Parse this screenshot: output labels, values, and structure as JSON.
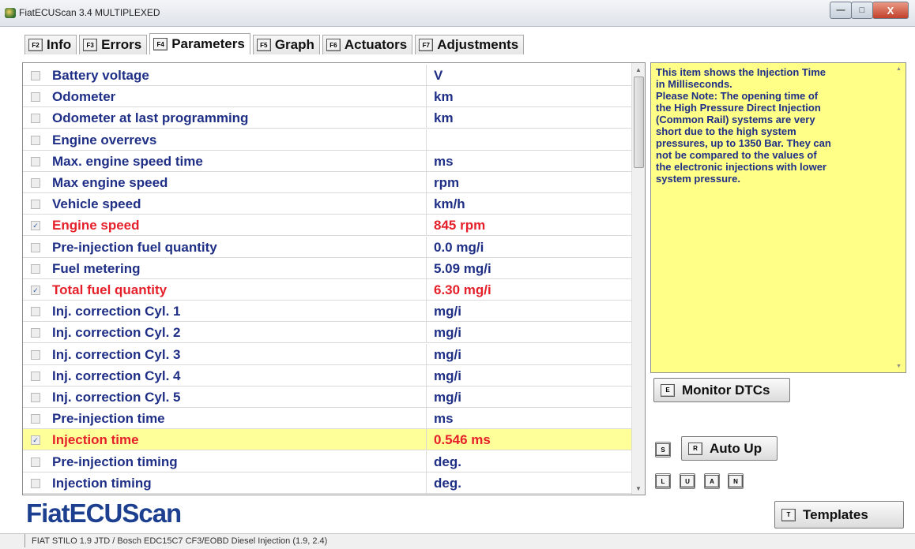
{
  "window": {
    "title": "FiatECUScan 3.4 MULTIPLEXED",
    "min_glyph": "—",
    "max_glyph": "□",
    "close_glyph": "X"
  },
  "tabs": [
    {
      "key": "F2",
      "label": "Info",
      "active": false
    },
    {
      "key": "F3",
      "label": "Errors",
      "active": false
    },
    {
      "key": "F4",
      "label": "Parameters",
      "active": true
    },
    {
      "key": "F5",
      "label": "Graph",
      "active": false
    },
    {
      "key": "F6",
      "label": "Actuators",
      "active": false
    },
    {
      "key": "F7",
      "label": "Adjustments",
      "active": false
    }
  ],
  "parameters": [
    {
      "name": "Battery voltage",
      "value": "V",
      "checked": false,
      "highlight": false
    },
    {
      "name": "Odometer",
      "value": "km",
      "checked": false,
      "highlight": false
    },
    {
      "name": "Odometer at last programming",
      "value": "km",
      "checked": false,
      "highlight": false
    },
    {
      "name": "Engine overrevs",
      "value": "",
      "checked": false,
      "highlight": false
    },
    {
      "name": "Max. engine speed time",
      "value": "ms",
      "checked": false,
      "highlight": false
    },
    {
      "name": "Max engine speed",
      "value": "rpm",
      "checked": false,
      "highlight": false
    },
    {
      "name": "Vehicle speed",
      "value": "km/h",
      "checked": false,
      "highlight": false
    },
    {
      "name": "Engine speed",
      "value": "845 rpm",
      "checked": true,
      "highlight": false
    },
    {
      "name": "Pre-injection fuel quantity",
      "value": "0.0 mg/i",
      "checked": false,
      "highlight": false
    },
    {
      "name": "Fuel metering",
      "value": "5.09 mg/i",
      "checked": false,
      "highlight": false
    },
    {
      "name": "Total fuel quantity",
      "value": "6.30 mg/i",
      "checked": true,
      "highlight": false
    },
    {
      "name": "Inj. correction Cyl. 1",
      "value": "mg/i",
      "checked": false,
      "highlight": false
    },
    {
      "name": "Inj. correction Cyl. 2",
      "value": "mg/i",
      "checked": false,
      "highlight": false
    },
    {
      "name": "Inj. correction Cyl. 3",
      "value": "mg/i",
      "checked": false,
      "highlight": false
    },
    {
      "name": "Inj. correction Cyl. 4",
      "value": "mg/i",
      "checked": false,
      "highlight": false
    },
    {
      "name": "Inj. correction Cyl. 5",
      "value": "mg/i",
      "checked": false,
      "highlight": false
    },
    {
      "name": "Pre-injection time",
      "value": "ms",
      "checked": false,
      "highlight": false
    },
    {
      "name": "Injection time",
      "value": "0.546 ms",
      "checked": true,
      "highlight": true
    },
    {
      "name": "Pre-injection timing",
      "value": "deg.",
      "checked": false,
      "highlight": false
    },
    {
      "name": "Injection timing",
      "value": "deg.",
      "checked": false,
      "highlight": false
    }
  ],
  "info_panel": {
    "text": "This item shows the Injection Time\nin Milliseconds.\nPlease Note: The opening time of\nthe High Pressure Direct Injection\n(Common Rail) systems are very\nshort due to the high system\npressures, up to 1350 Bar. They can\nnot be compared to the values of\nthe electronic injections with lower\nsystem pressure."
  },
  "buttons": {
    "monitor_dtcs": {
      "key": "E",
      "label": "Monitor DTCs"
    },
    "s_key": "S",
    "auto_up": {
      "key": "R",
      "label": "Auto Up"
    },
    "small_keys": [
      "L",
      "U",
      "A",
      "N"
    ],
    "templates": {
      "key": "T",
      "label": "Templates"
    }
  },
  "logo": "FiatECUScan",
  "status": "FIAT STILO 1.9 JTD / Bosch EDC15C7 CF3/EOBD Diesel Injection (1.9, 2.4)",
  "colors": {
    "param_text": "#1f2f86",
    "selected_text": "#e5202a",
    "highlight_row": "#ffff99",
    "info_bg": "#ffff88",
    "logo": "#1d3f8f"
  }
}
